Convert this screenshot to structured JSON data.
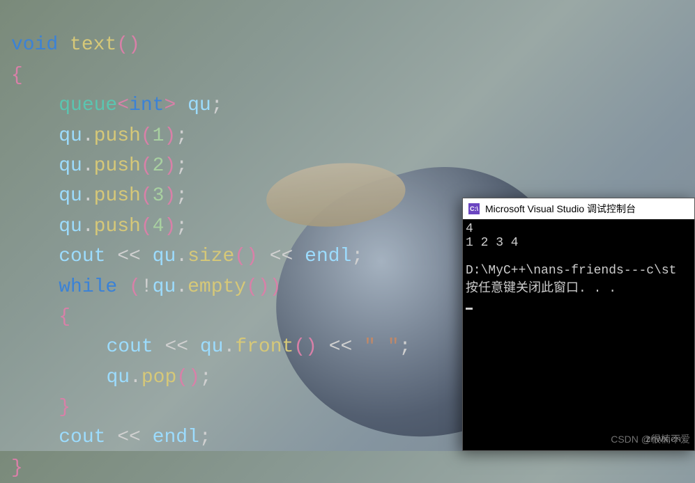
{
  "code": {
    "l1": {
      "kw": "void",
      "fn": "text",
      "p1": "(",
      "p2": ")"
    },
    "l2": {
      "br": "{"
    },
    "l3": {
      "type": "queue",
      "lt": "<",
      "kw": "int",
      "gt": ">",
      "sp": " ",
      "id": "qu",
      "sc": ";"
    },
    "l4": {
      "id": "qu",
      "dot": ".",
      "fn": "push",
      "p1": "(",
      "n": "1",
      "p2": ")",
      "sc": ";"
    },
    "l5": {
      "id": "qu",
      "dot": ".",
      "fn": "push",
      "p1": "(",
      "n": "2",
      "p2": ")",
      "sc": ";"
    },
    "l6": {
      "id": "qu",
      "dot": ".",
      "fn": "push",
      "p1": "(",
      "n": "3",
      "p2": ")",
      "sc": ";"
    },
    "l7": {
      "id": "qu",
      "dot": ".",
      "fn": "push",
      "p1": "(",
      "n": "4",
      "p2": ")",
      "sc": ";"
    },
    "l8": {
      "id1": "cout",
      "op1": " << ",
      "id2": "qu",
      "dot": ".",
      "fn": "size",
      "p1": "(",
      "p2": ")",
      "op2": " << ",
      "id3": "endl",
      "sc": ";"
    },
    "l9": {
      "kw": "while",
      "sp": " ",
      "p1": "(",
      "bang": "!",
      "id": "qu",
      "dot": ".",
      "fn": "empty",
      "p3": "(",
      "p4": ")",
      "p2": ")"
    },
    "l10": {
      "br": "{"
    },
    "l11": {
      "id1": "cout",
      "op1": " << ",
      "id2": "qu",
      "dot": ".",
      "fn": "front",
      "p1": "(",
      "p2": ")",
      "op2": " << ",
      "str": "\" \"",
      "sc": ";"
    },
    "l12": {
      "id": "qu",
      "dot": ".",
      "fn": "pop",
      "p1": "(",
      "p2": ")",
      "sc": ";"
    },
    "l13": {
      "br": "}"
    },
    "l14": {
      "id1": "cout",
      "op": " << ",
      "id2": "endl",
      "sc": ";"
    },
    "l15": {
      "br": "}"
    }
  },
  "console": {
    "icon": "C:\\",
    "title": "Microsoft Visual Studio 调试控制台",
    "line1": "4",
    "line2": "1 2 3 4",
    "line3": "",
    "line4": "D:\\MyC++\\nans-friends---c\\st",
    "line5": "按任意键关闭此窗口. . ."
  },
  "watermark1": "znwx.cn",
  "watermark2": "CSDN @很楠不爱"
}
